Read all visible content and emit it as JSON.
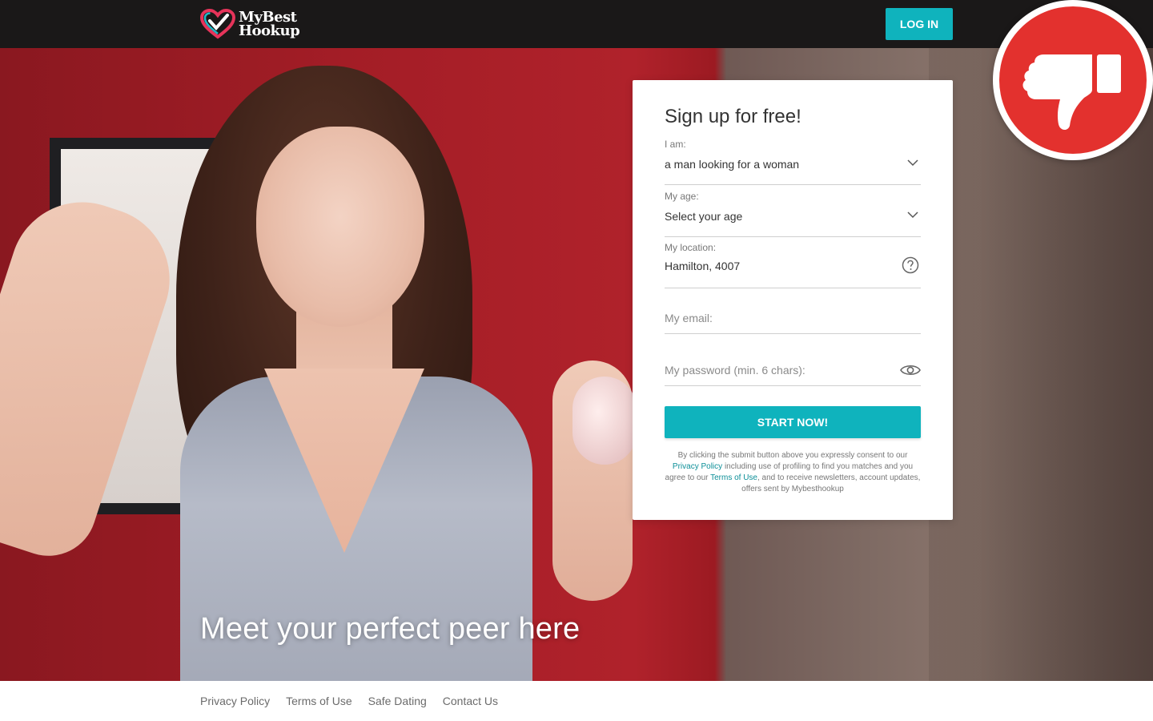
{
  "header": {
    "logo_line1": "MyBest",
    "logo_line2": "Hookup",
    "login_label": "LOG IN"
  },
  "hero": {
    "title": "Meet your perfect peer here"
  },
  "signup": {
    "title": "Sign up for free!",
    "i_am_label": "I am:",
    "i_am_value": "a man looking for a woman",
    "age_label": "My age:",
    "age_value": "Select your age",
    "location_label": "My location:",
    "location_value": "Hamilton, 4007",
    "email_placeholder": "My email:",
    "password_placeholder": "My password (min. 6 chars):",
    "submit_label": "START NOW!",
    "legal": {
      "part1": "By clicking the submit button above you expressly consent to our",
      "privacy_link": "Privacy Policy",
      "part2": "including use of profiling to find you matches and you agree to our",
      "terms_link": "Terms of Use",
      "part3": ", and to receive newsletters, account updates, offers sent by Mybesthookup"
    }
  },
  "badge": {
    "icon": "thumbs-down-icon",
    "color": "#e3312e"
  },
  "footer": {
    "links": [
      "Privacy Policy",
      "Terms of Use",
      "Safe Dating",
      "Contact Us"
    ]
  },
  "colors": {
    "accent": "#0fb3bd",
    "topbar": "#1a1818"
  }
}
